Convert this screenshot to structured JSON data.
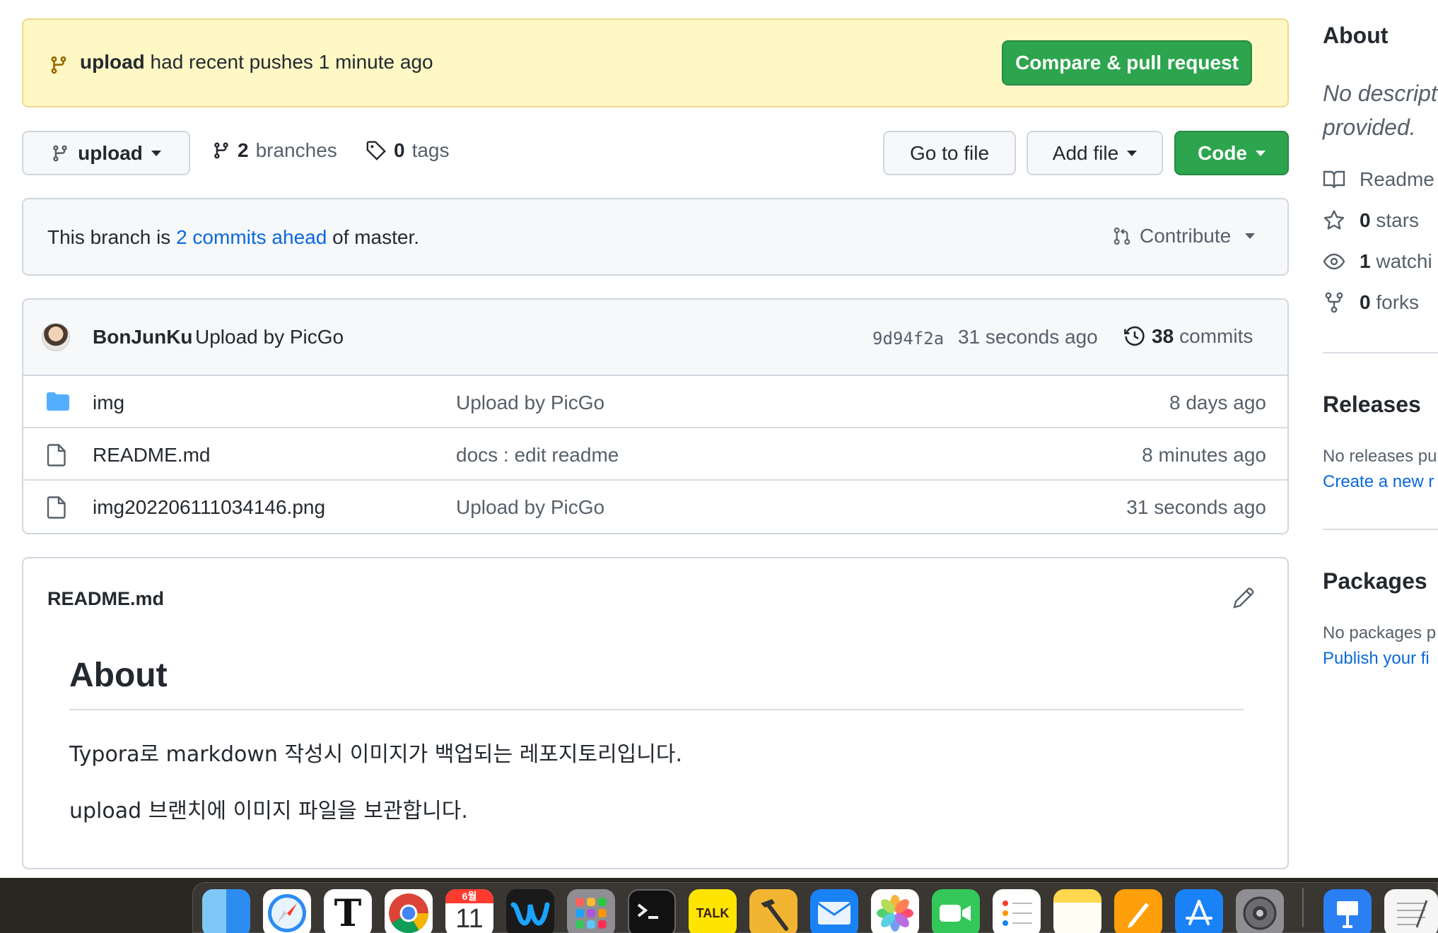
{
  "banner": {
    "branch": "upload",
    "text": "had recent pushes 1 minute ago",
    "button": "Compare & pull request"
  },
  "toolbar": {
    "branch": "upload",
    "branches_count": "2",
    "branches_label": "branches",
    "tags_count": "0",
    "tags_label": "tags",
    "goto": "Go to file",
    "addfile": "Add file",
    "code": "Code"
  },
  "ahead": {
    "prefix": "This branch is",
    "link": "2 commits ahead",
    "suffix": "of master.",
    "contribute": "Contribute"
  },
  "latest_commit": {
    "author": "BonJunKu",
    "message": "Upload by PicGo",
    "sha": "9d94f2a",
    "when": "31 seconds ago",
    "commits_count": "38",
    "commits_label": "commits"
  },
  "files": [
    {
      "name": "img",
      "type": "folder",
      "message": "Upload by PicGo",
      "age": "8 days ago"
    },
    {
      "name": "README.md",
      "type": "file",
      "message": "docs : edit readme",
      "age": "8 minutes ago"
    },
    {
      "name": "img202206111034146.png",
      "type": "file",
      "message": "Upload by PicGo",
      "age": "31 seconds ago"
    }
  ],
  "readme": {
    "filename": "README.md",
    "heading": "About",
    "p1": "Typora로 markdown 작성시 이미지가 백업되는 레포지토리입니다.",
    "p2": "upload 브랜치에 이미지 파일을 보관합니다."
  },
  "sidebar": {
    "about_title": "About",
    "desc1": "No descript",
    "desc2": "provided.",
    "readme": "Readme",
    "stars_count": "0",
    "stars_label": "stars",
    "watching_count": "1",
    "watching_label": "watchi",
    "forks_count": "0",
    "forks_label": "forks",
    "releases_title": "Releases",
    "releases_none": "No releases pu",
    "releases_link": "Create a new r",
    "packages_title": "Packages",
    "packages_none": "No packages p",
    "packages_link": "Publish your fi"
  },
  "dock": {
    "calendar_month": "6월",
    "calendar_day": "11",
    "talk": "TALK",
    "typora": "T"
  },
  "colors": {
    "accent_green": "#2da44e",
    "link_blue": "#0969da",
    "banner_bg": "#fff8c5"
  }
}
